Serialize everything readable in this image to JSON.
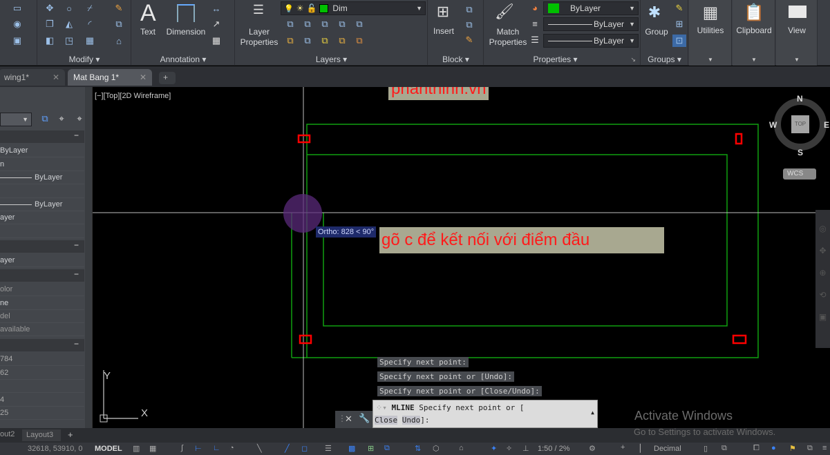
{
  "ribbon": {
    "panels": {
      "modify": "Modify ▾",
      "annotation": "Annotation ▾",
      "layers": "Layers ▾",
      "block": "Block ▾",
      "properties": "Properties ▾",
      "groups": "Groups ▾"
    },
    "buttons": {
      "text": "Text",
      "dimension": "Dimension",
      "layer_properties_1": "Layer",
      "layer_properties_2": "Properties",
      "insert": "Insert",
      "match_properties_1": "Match",
      "match_properties_2": "Properties",
      "group": "Group",
      "utilities": "Utilities",
      "clipboard": "Clipboard",
      "view": "View"
    },
    "layer_combo": "Dim",
    "color_combo": "ByLayer",
    "linetype_combo": "ByLayer",
    "lineweight_combo": "ByLayer",
    "layer_color": "#00c000"
  },
  "tabs": [
    {
      "label": "wing1*"
    },
    {
      "label": "Mat Bang 1*"
    }
  ],
  "viewport_label": "[−][Top][2D Wireframe]",
  "watermark": "phanthinh.vn",
  "annotation_text": "gõ c để kết nối với điểm đầu",
  "ortho_tooltip": "Ortho: 828 < 90°",
  "viewcube": {
    "n": "N",
    "s": "S",
    "e": "E",
    "w": "W",
    "top": "TOP",
    "wcs": "WCS"
  },
  "ucs": {
    "x": "X",
    "y": "Y"
  },
  "sidebar": {
    "rows": [
      "ByLayer",
      "n",
      "ByLayer",
      "ByLayer",
      "ayer",
      "ayer",
      "olor",
      "ne",
      "del",
      "available",
      "784",
      "62",
      "4",
      "25"
    ]
  },
  "command": {
    "history": [
      "Specify next point:",
      "Specify next point or [Undo]:",
      "Specify next point or [Close/Undo]:"
    ],
    "prompt_cmd": "MLINE",
    "prompt_text": "Specify next point or [",
    "opt_close": "Close",
    "opt_undo": "Undo",
    "prompt_end": "]:"
  },
  "layout_tabs": [
    "out2",
    "Layout3"
  ],
  "status": {
    "coords": "32618, 53910, 0",
    "model": "MODEL",
    "scale": "1:50 / 2%",
    "units": "Decimal"
  },
  "activate": {
    "title": "Activate Windows",
    "sub": "Go to Settings to activate Windows."
  }
}
